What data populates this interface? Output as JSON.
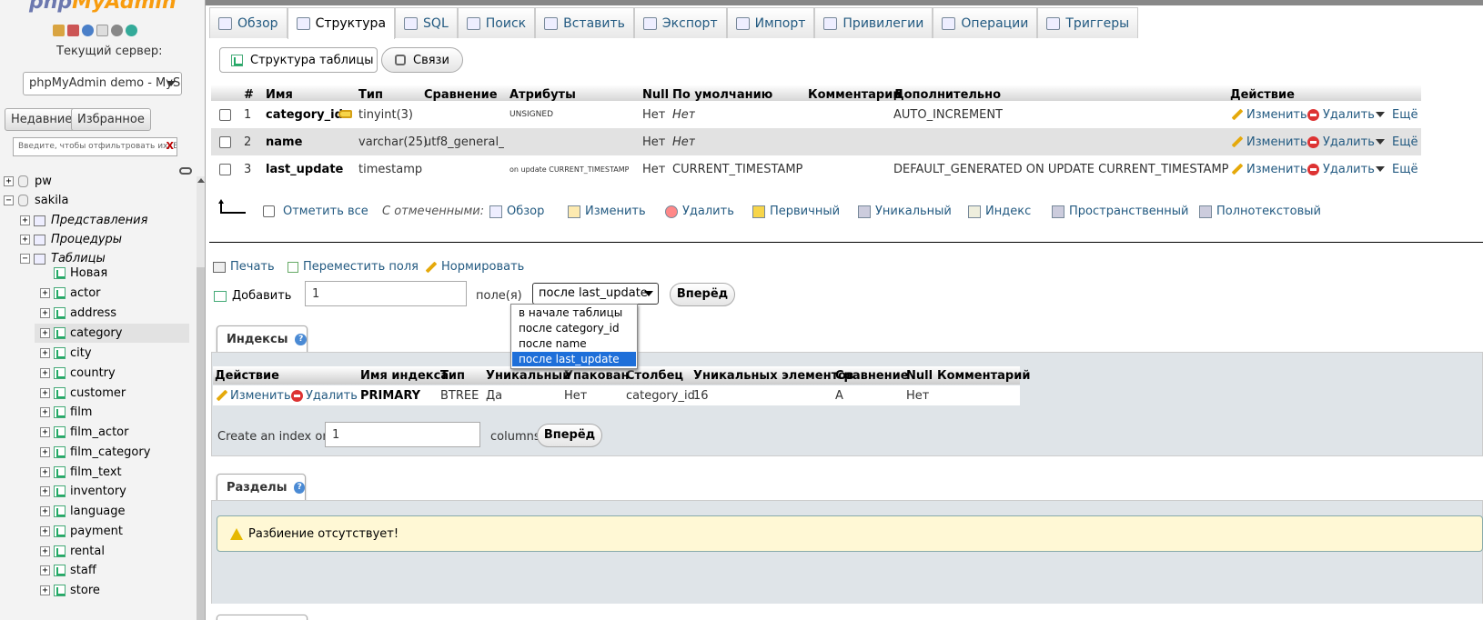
{
  "nav": {
    "logo_a": "php",
    "logo_b": "MyAdmin",
    "current_server_label": "Текущий сервер:",
    "server_select": "phpMyAdmin demo - MyS",
    "recent_button": "Недавние",
    "favorites_button": "Избранное",
    "filter_placeholder": "Введите, чтобы отфильтровать их, Ent",
    "filter_clear": "X",
    "tree": [
      {
        "label": "pw",
        "level": 0
      },
      {
        "label": "sakila",
        "level": 0
      },
      {
        "label": "Представления",
        "level": 1
      },
      {
        "label": "Процедуры",
        "level": 1
      },
      {
        "label": "Таблицы",
        "level": 1
      },
      {
        "label": "Новая",
        "level": 2
      },
      {
        "label": "actor",
        "level": 2
      },
      {
        "label": "address",
        "level": 2
      },
      {
        "label": "category",
        "level": 2
      },
      {
        "label": "city",
        "level": 2
      },
      {
        "label": "country",
        "level": 2
      },
      {
        "label": "customer",
        "level": 2
      },
      {
        "label": "film",
        "level": 2
      },
      {
        "label": "film_actor",
        "level": 2
      },
      {
        "label": "film_category",
        "level": 2
      },
      {
        "label": "film_text",
        "level": 2
      },
      {
        "label": "inventory",
        "level": 2
      },
      {
        "label": "language",
        "level": 2
      },
      {
        "label": "payment",
        "level": 2
      },
      {
        "label": "rental",
        "level": 2
      },
      {
        "label": "staff",
        "level": 2
      },
      {
        "label": "store",
        "level": 2
      }
    ]
  },
  "tabs": [
    "Обзор",
    "Структура",
    "SQL",
    "Поиск",
    "Вставить",
    "Экспорт",
    "Импорт",
    "Привилегии",
    "Операции",
    "Триггеры"
  ],
  "subtabs": [
    "Структура таблицы",
    "Связи"
  ],
  "columns_table": {
    "headers": [
      "#",
      "Имя",
      "Тип",
      "Сравнение",
      "Атрибуты",
      "Null",
      "По умолчанию",
      "Комментарии",
      "Дополнительно",
      "Действие"
    ],
    "rows": [
      {
        "num": "1",
        "name": "category_id",
        "type": "tinyint(3)",
        "collation": "",
        "attributes": "UNSIGNED",
        "null": "Нет",
        "default": "Нет",
        "comments": "",
        "extra": "AUTO_INCREMENT"
      },
      {
        "num": "2",
        "name": "name",
        "type": "varchar(25)",
        "collation": "utf8_general_ci",
        "attributes": "",
        "null": "Нет",
        "default": "Нет",
        "comments": "",
        "extra": ""
      },
      {
        "num": "3",
        "name": "last_update",
        "type": "timestamp",
        "collation": "",
        "attributes": "on update CURRENT_TIMESTAMP",
        "null": "Нет",
        "default": "CURRENT_TIMESTAMP",
        "comments": "",
        "extra": "DEFAULT_GENERATED ON UPDATE CURRENT_TIMESTAMP"
      }
    ],
    "row_actions": {
      "edit": "Изменить",
      "delete": "Удалить",
      "more": "Ещё"
    }
  },
  "bulk": {
    "check_all": "Отметить все",
    "with_selected": "С отмеченными:",
    "actions": [
      "Обзор",
      "Изменить",
      "Удалить",
      "Первичный",
      "Уникальный",
      "Индекс",
      "Пространственный",
      "Полнотекстовый"
    ]
  },
  "tools": {
    "print": "Печать",
    "move": "Переместить поля",
    "normalize": "Нормировать"
  },
  "add_field": {
    "label": "Добавить",
    "count": "1",
    "fields_label": "поле(я)",
    "position_selected": "после last_update",
    "options": [
      "в начале таблицы",
      "после category_id",
      "после name",
      "после last_update"
    ],
    "go": "Вперёд"
  },
  "indexes": {
    "title": "Индексы",
    "headers": [
      "Действие",
      "Имя индекса",
      "Тип",
      "Уникальный",
      "Упакован",
      "Столбец",
      "Уникальных элементов",
      "Сравнение",
      "Null",
      "Комментарий"
    ],
    "row": {
      "edit": "Изменить",
      "delete": "Удалить",
      "name": "PRIMARY",
      "type": "BTREE",
      "unique": "Да",
      "packed": "Нет",
      "column": "category_id",
      "cardinality": "16",
      "collation": "A",
      "null": "Нет",
      "comment": ""
    },
    "create_prefix": "Create an index on",
    "create_count": "1",
    "create_suffix": "columns",
    "go": "Вперёд"
  },
  "partitions": {
    "title": "Разделы",
    "notice": "Разбиение отсутствует!"
  }
}
